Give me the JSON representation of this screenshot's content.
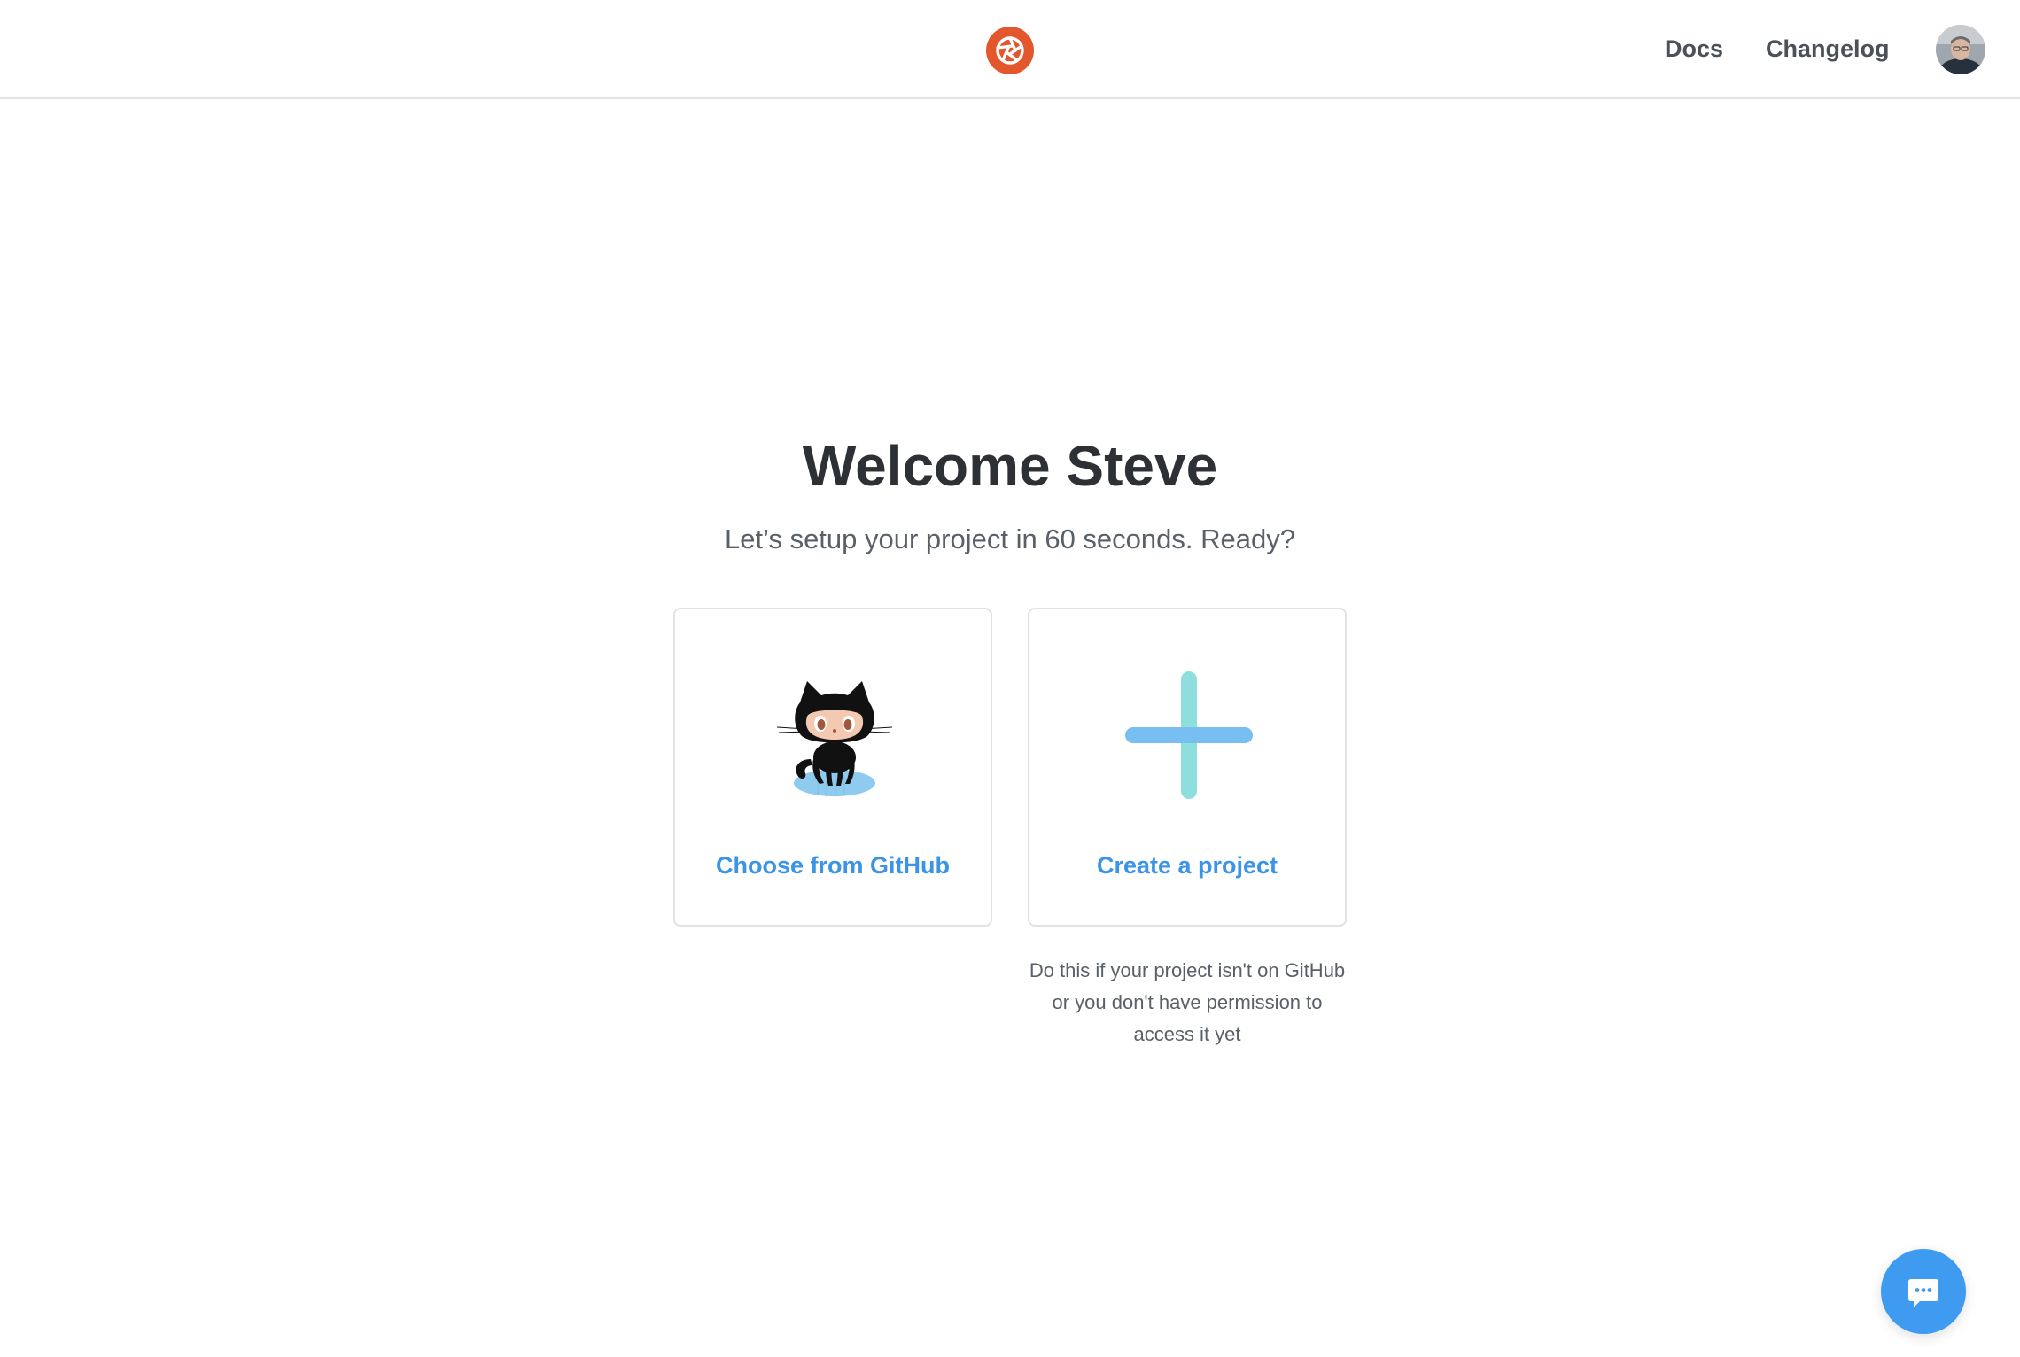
{
  "header": {
    "logo_icon": "brand-logo-icon",
    "brand_color": "#e2572c",
    "nav": {
      "docs": "Docs",
      "changelog": "Changelog"
    },
    "avatar_icon": "user-avatar"
  },
  "main": {
    "title": "Welcome Steve",
    "subtitle": "Let’s setup your project in 60 seconds. Ready?",
    "options": {
      "github": {
        "label": "Choose from GitHub",
        "icon": "octocat-icon"
      },
      "create": {
        "label": "Create a project",
        "icon": "plus-icon",
        "hint": "Do this if your project isn't on GitHub or you don't have permission to access it yet"
      }
    },
    "accent_color": "#3b94e6"
  },
  "chat_widget": {
    "icon": "chat-icon",
    "color": "#3f9bf0"
  }
}
